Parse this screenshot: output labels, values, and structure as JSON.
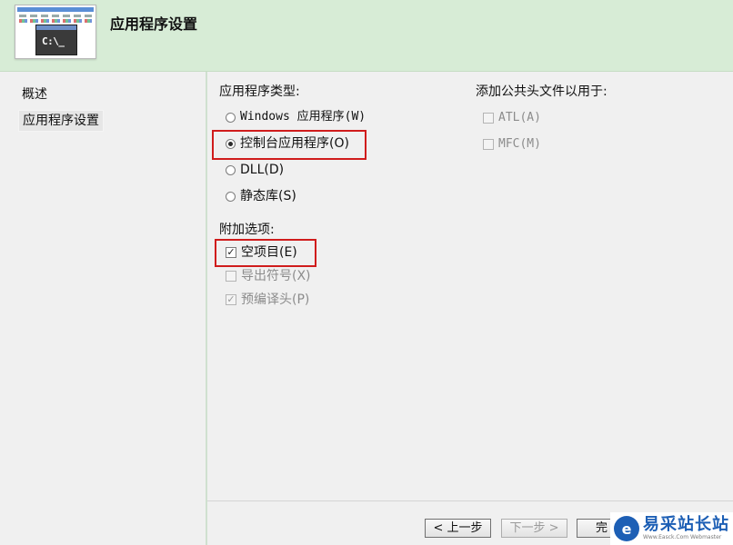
{
  "header": {
    "title": "应用程序设置",
    "thumbnail_prompt": "C:\\_"
  },
  "sidebar": {
    "items": [
      {
        "label": "概述"
      },
      {
        "label": "应用程序设置"
      }
    ]
  },
  "app_type": {
    "title": "应用程序类型:",
    "options": [
      {
        "label": "Windows 应用程序(W)",
        "checked": false
      },
      {
        "label": "控制台应用程序(O)",
        "checked": true
      },
      {
        "label": "DLL(D)",
        "checked": false
      },
      {
        "label": "静态库(S)",
        "checked": false
      }
    ]
  },
  "extra": {
    "title": "附加选项:",
    "options": [
      {
        "label": "空项目(E)",
        "checked": true,
        "enabled": true
      },
      {
        "label": "导出符号(X)",
        "checked": false,
        "enabled": false
      },
      {
        "label": "预编译头(P)",
        "checked": true,
        "enabled": false
      }
    ]
  },
  "headers": {
    "title": "添加公共头文件以用于:",
    "options": [
      {
        "label": "ATL(A)",
        "checked": false,
        "enabled": false
      },
      {
        "label": "MFC(M)",
        "checked": false,
        "enabled": false
      }
    ]
  },
  "buttons": {
    "back": "< 上一步",
    "next": "下一步 >",
    "finish": "完"
  },
  "watermark": {
    "logo_letter": "e",
    "name": "易采站长站",
    "url": "Www.Easck.Com Webmaster"
  },
  "colors": {
    "header_bg": "#d7ecd6",
    "highlight": "#d01c1c",
    "brand": "#1d5fb5"
  }
}
